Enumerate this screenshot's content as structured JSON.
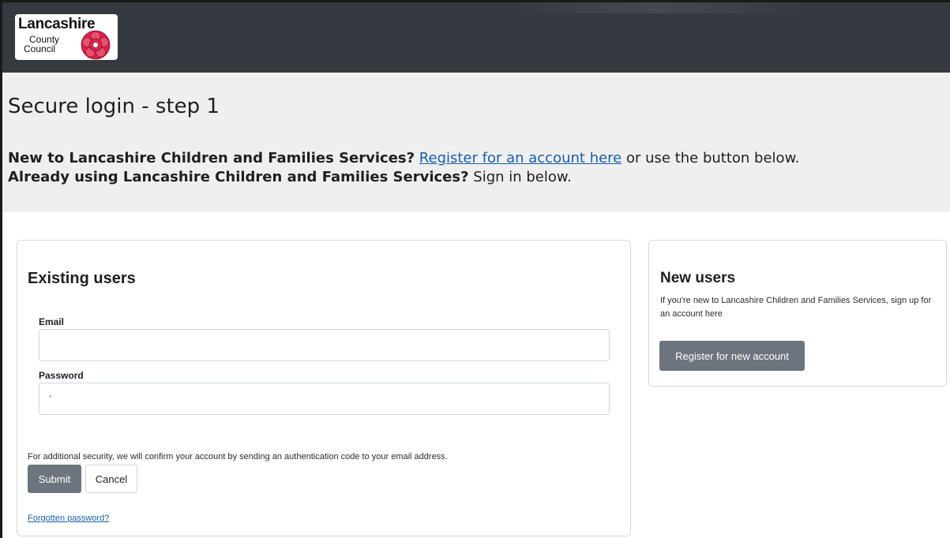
{
  "header": {
    "logo_text": "Lancashire",
    "logo_sub1": "County",
    "logo_sub2": "Council"
  },
  "hero": {
    "title": "Secure login - step 1",
    "line1_bold": "New to Lancashire Children and Families Services?",
    "line1_link": "Register for an account here",
    "line1_rest": " or use the button below.",
    "line2_bold": "Already using Lancashire Children and Families Services?",
    "line2_rest": " Sign in below."
  },
  "existing": {
    "heading": "Existing users",
    "email_label": "Email",
    "email_value": "",
    "password_label": "Password",
    "password_value": "´",
    "security_note": "For additional security, we will confirm your account by sending an authentication code to your email address.",
    "submit_label": "Submit",
    "cancel_label": "Cancel",
    "forgot_label": "Forgotten password?"
  },
  "new_users": {
    "heading": "New users",
    "description": "If you're new to Lancashire Children and Families Services, sign up for an account here",
    "register_label": "Register for new account"
  },
  "colors": {
    "header_bg": "#343a40",
    "hero_bg": "#efefef",
    "link": "#1a5fa8",
    "button": "#6c757d",
    "logo_rose": "#d6254c"
  },
  "icons": {
    "logo_emblem": "red-rose-icon"
  }
}
